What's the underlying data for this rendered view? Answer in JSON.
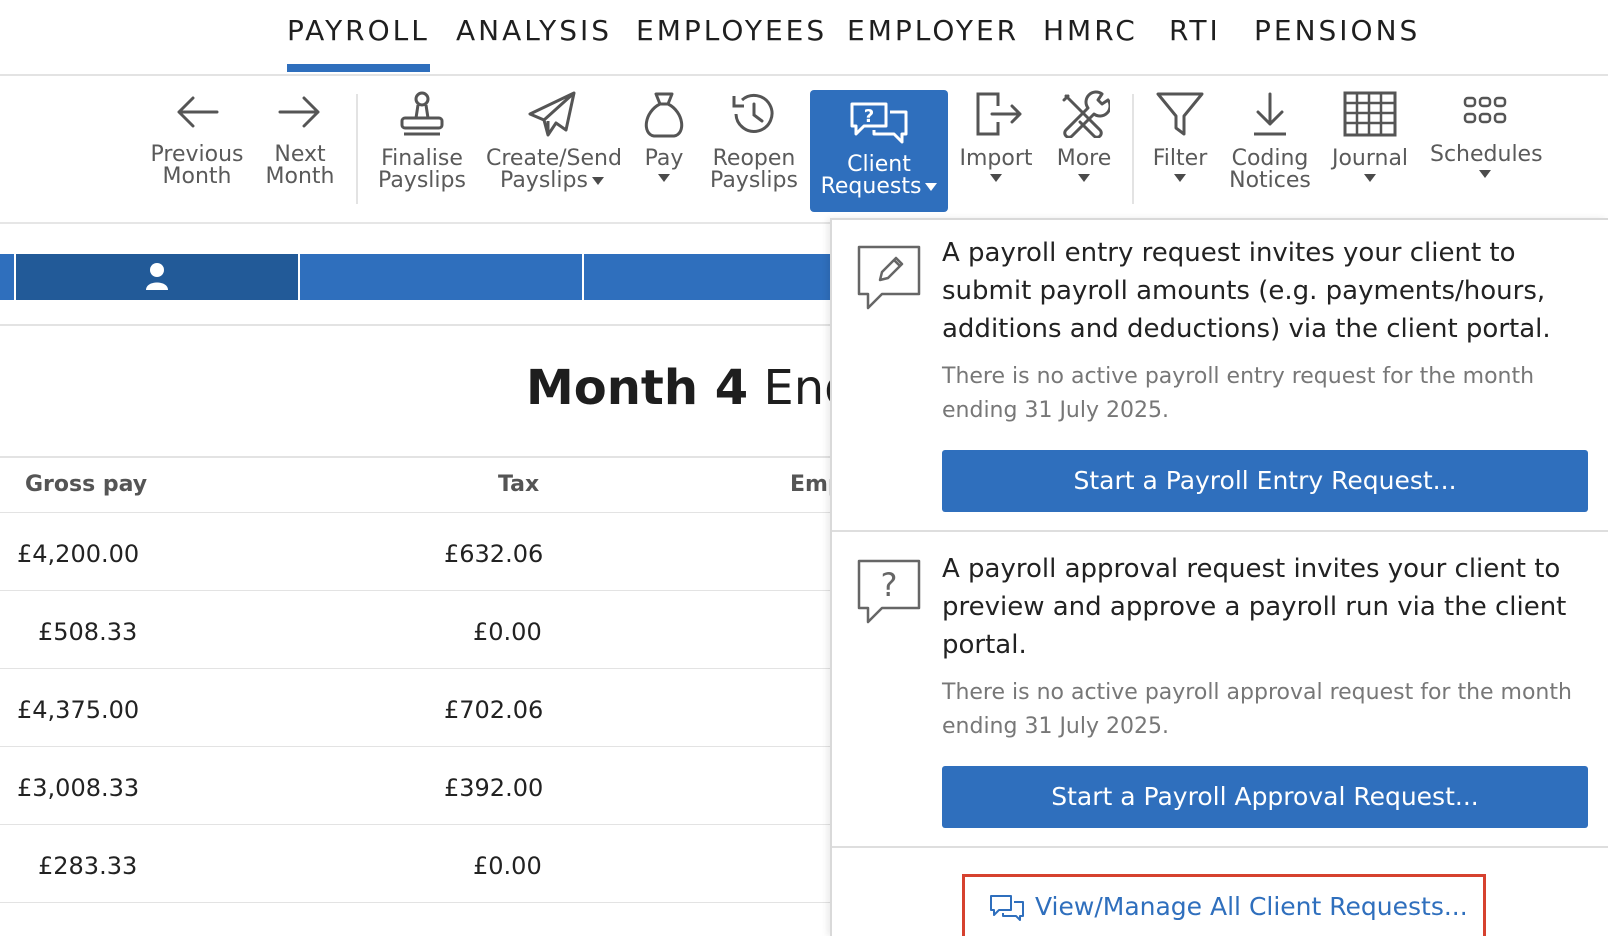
{
  "topnav": {
    "tabs": [
      {
        "label": "PAYROLL",
        "active": true
      },
      {
        "label": "ANALYSIS"
      },
      {
        "label": "EMPLOYEES"
      },
      {
        "label": "EMPLOYER"
      },
      {
        "label": "HMRC"
      },
      {
        "label": "RTI"
      },
      {
        "label": "PENSIONS"
      }
    ]
  },
  "toolbar": {
    "previous_month": [
      "Previous",
      "Month"
    ],
    "next_month": [
      "Next",
      "Month"
    ],
    "finalise_payslips": [
      "Finalise",
      "Payslips"
    ],
    "create_send_payslips": [
      "Create/Send",
      "Payslips"
    ],
    "pay": "Pay",
    "reopen_payslips": [
      "Reopen",
      "Payslips"
    ],
    "client_requests": [
      "Client",
      "Requests"
    ],
    "import": "Import",
    "more": "More",
    "filter": "Filter",
    "coding_notices": [
      "Coding",
      "Notices"
    ],
    "journal": "Journal",
    "schedules": "Schedules"
  },
  "main": {
    "title_bold": "Month 4",
    "title_rest": " End",
    "columns": [
      "Gross pay",
      "Tax",
      "Emp"
    ],
    "rows": [
      {
        "gross": "£4,200.00",
        "tax": "£632.06"
      },
      {
        "gross": "£508.33",
        "tax": "£0.00"
      },
      {
        "gross": "£4,375.00",
        "tax": "£702.06"
      },
      {
        "gross": "£3,008.33",
        "tax": "£392.00"
      },
      {
        "gross": "£283.33",
        "tax": "£0.00"
      }
    ]
  },
  "dropdown": {
    "entry": {
      "description": "A payroll entry request invites your client to submit payroll amounts (e.g. payments/hours, additions and deductions) via the client portal.",
      "note": "There is no active payroll entry request for the month ending 31 July 2025.",
      "button": "Start a Payroll Entry Request..."
    },
    "approval": {
      "description": "A payroll approval request invites your client to preview and approve a payroll run via the client portal.",
      "note": "There is no active payroll approval request for the month ending 31 July 2025.",
      "button": "Start a Payroll Approval Request..."
    },
    "manage_link": "View/Manage All Client Requests..."
  },
  "colors": {
    "accent": "#2f6fbd",
    "accent_dark": "#225a98",
    "highlight": "#d6412f"
  }
}
